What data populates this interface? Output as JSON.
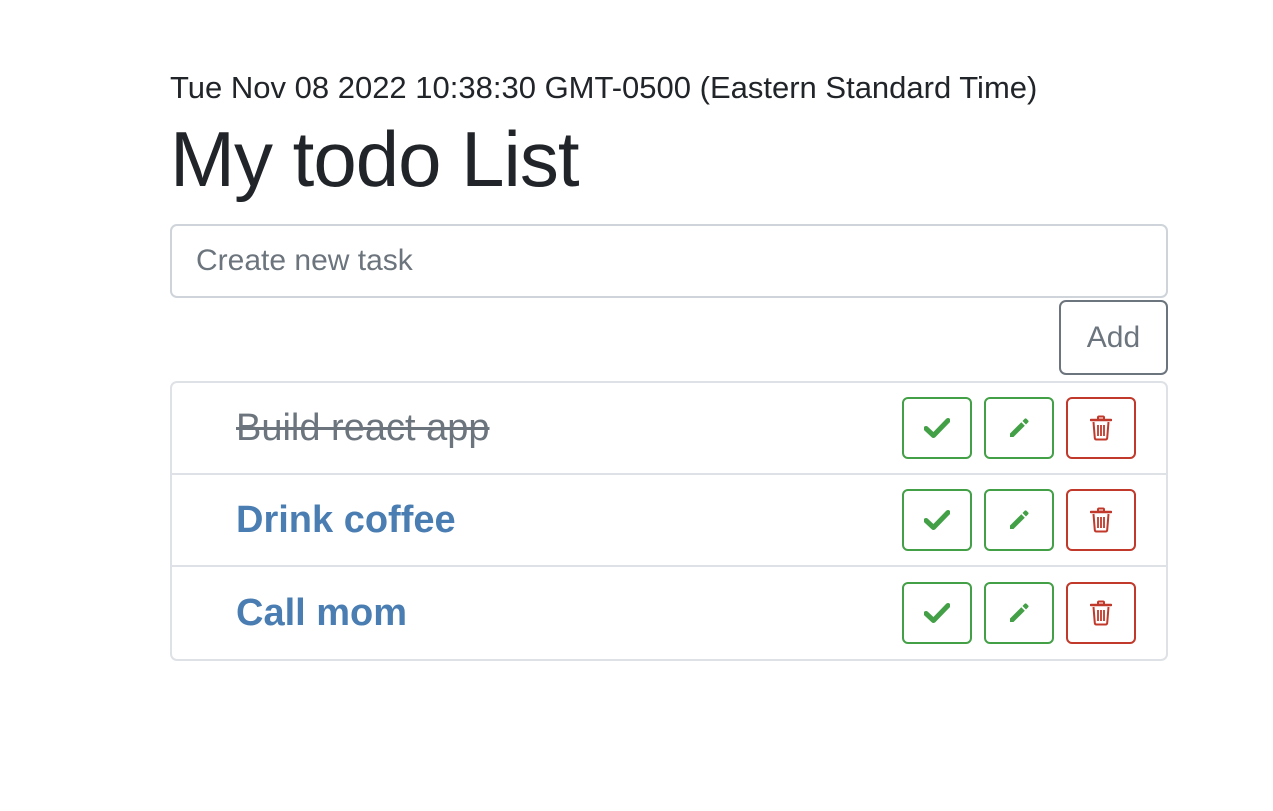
{
  "header": {
    "timestamp": "Tue Nov 08 2022 10:38:30 GMT-0500 (Eastern Standard Time)",
    "title": "My todo List"
  },
  "new_task": {
    "value": "",
    "placeholder": "Create new task",
    "add_label": "Add"
  },
  "tasks": [
    {
      "label": "Build react app",
      "done": true
    },
    {
      "label": "Drink coffee",
      "done": false
    },
    {
      "label": "Call mom",
      "done": false
    }
  ],
  "icons": {
    "complete": "check-icon",
    "edit": "pencil-icon",
    "delete": "trash-icon"
  },
  "colors": {
    "success": "#43a047",
    "danger": "#c0392b",
    "task_link": "#4a7db1",
    "task_done": "#6c757d",
    "secondary": "#6c757d"
  }
}
